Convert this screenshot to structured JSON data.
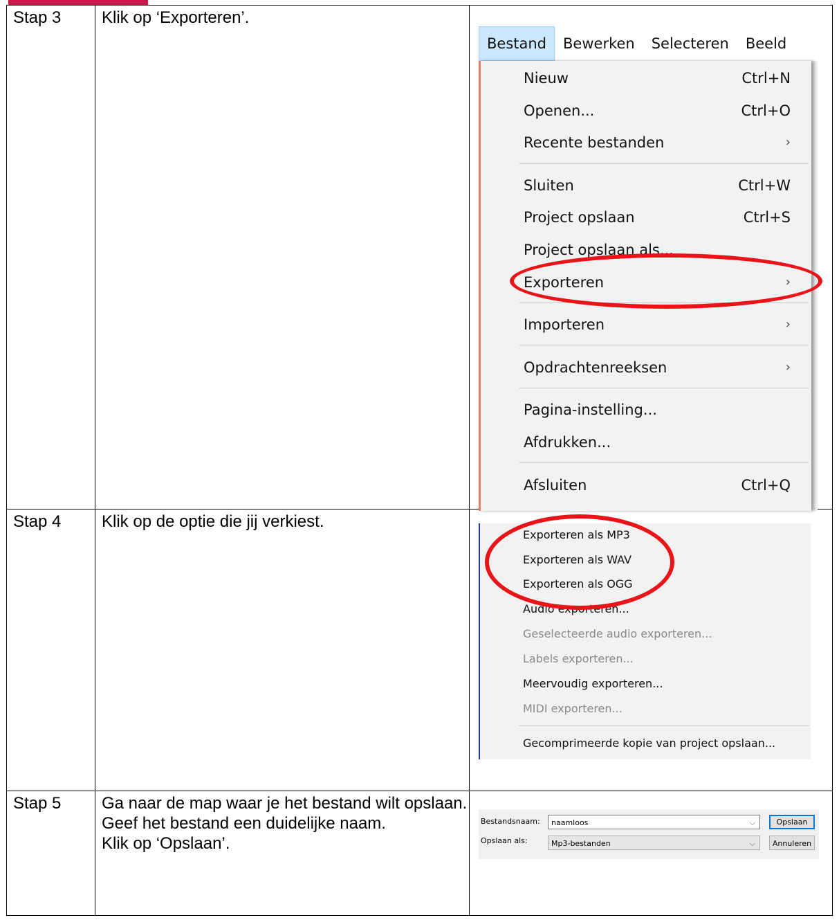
{
  "accent_color": "#c8174a",
  "highlight_color": "#e8141a",
  "steps": [
    {
      "label": "Stap 3",
      "instruction": [
        "Klik op ‘Exporteren’."
      ],
      "menu": {
        "bar": [
          "Bestand",
          "Bewerken",
          "Selecteren",
          "Beeld"
        ],
        "items": [
          {
            "label": "Nieuw",
            "shortcut": "Ctrl+N"
          },
          {
            "label": "Openen...",
            "shortcut": "Ctrl+O"
          },
          {
            "label": "Recente bestanden",
            "arrow": "›"
          },
          {
            "label": "Sluiten",
            "shortcut": "Ctrl+W"
          },
          {
            "label": "Project opslaan",
            "shortcut": "Ctrl+S"
          },
          {
            "label": "Project opslaan als..."
          },
          {
            "label": "Exporteren",
            "arrow": "›"
          },
          {
            "label": "Importeren",
            "arrow": "›"
          },
          {
            "label": "Opdrachtenreeksen",
            "arrow": "›"
          },
          {
            "label": "Pagina-instelling..."
          },
          {
            "label": "Afdrukken..."
          },
          {
            "label": "Afsluiten",
            "shortcut": "Ctrl+Q"
          }
        ]
      }
    },
    {
      "label": "Stap 4",
      "instruction": [
        "Klik op de optie die jij verkiest."
      ],
      "export_items": [
        {
          "label": "Exporteren als MP3",
          "enabled": true
        },
        {
          "label": "Exporteren als WAV",
          "enabled": true
        },
        {
          "label": "Exporteren als OGG",
          "enabled": true
        },
        {
          "label": "Audio exporteren...",
          "enabled": true
        },
        {
          "label": "Geselecteerde audio exporteren...",
          "enabled": false
        },
        {
          "label": "Labels exporteren...",
          "enabled": false
        },
        {
          "label": "Meervoudig exporteren...",
          "enabled": true
        },
        {
          "label": "MIDI exporteren...",
          "enabled": false
        },
        {
          "label": "Gecomprimeerde kopie van project opslaan...",
          "enabled": true
        }
      ]
    },
    {
      "label": "Stap 5",
      "instruction": [
        "Ga naar de map waar je het bestand wilt opslaan.",
        "Geef het bestand een duidelijke naam.",
        "Klik op ‘Opslaan’."
      ],
      "dialog": {
        "filename_label": "Bestandsnaam:",
        "filename_value": "naamloos",
        "type_label": "Opslaan als:",
        "type_value": "Mp3-bestanden",
        "save_button": "Opslaan",
        "cancel_button": "Annuleren",
        "chevron": "⌵"
      }
    }
  ]
}
